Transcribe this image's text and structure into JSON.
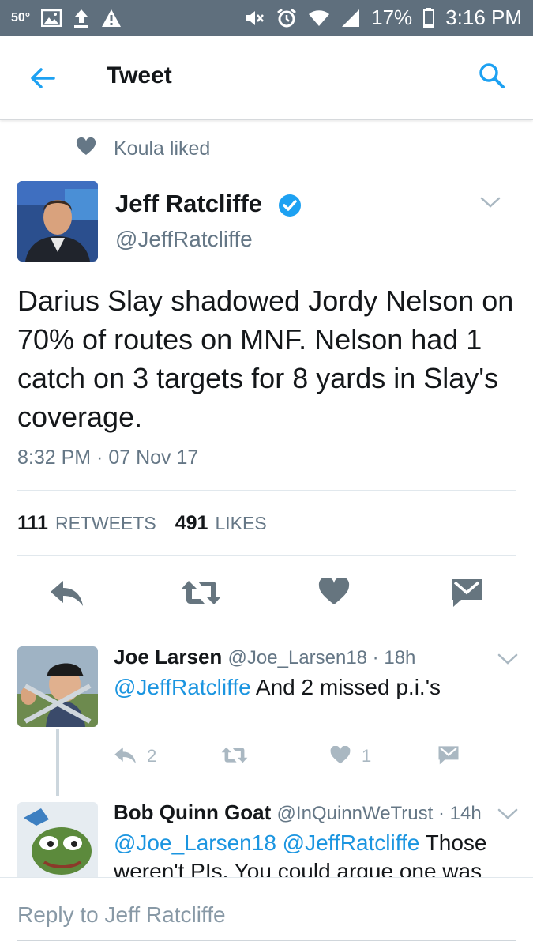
{
  "status_bar": {
    "temperature": "50°",
    "battery_percent": "17%",
    "time": "3:16 PM",
    "left_icons": [
      "image-icon",
      "upload-icon",
      "warning-icon"
    ],
    "right_icons": [
      "mute-icon",
      "alarm-icon",
      "wifi-icon",
      "signal-icon",
      "battery-icon"
    ]
  },
  "header": {
    "title": "Tweet",
    "back_icon": "back-arrow-icon",
    "search_icon": "search-icon"
  },
  "liked_by": {
    "text": "Koula liked",
    "icon": "heart-icon"
  },
  "tweet": {
    "author_name": "Jeff Ratcliffe",
    "author_handle": "@JeffRatcliffe",
    "verified": true,
    "text": "Darius Slay shadowed Jordy Nelson on 70% of routes on MNF. Nelson had 1 catch on 3 targets for 8 yards in Slay's coverage.",
    "timestamp": "8:32 PM · 07 Nov 17",
    "retweets_count": "111",
    "retweets_label": "RETWEETS",
    "likes_count": "491",
    "likes_label": "LIKES",
    "actions": [
      "reply-icon",
      "retweet-icon",
      "like-icon",
      "message-icon"
    ]
  },
  "replies": [
    {
      "name": "Joe Larsen",
      "handle": "@Joe_Larsen18",
      "time": "18h",
      "mentions": "@JeffRatcliffe",
      "text": "And 2 missed p.i.'s",
      "reply_count": "2",
      "like_count": "1"
    },
    {
      "name": "Bob Quinn Goat",
      "handle": "@InQuinnWeTrust",
      "time": "14h",
      "mentions": "@Joe_Larsen18 @JeffRatcliffe",
      "text_line1": "Those",
      "text_line2": "weren't PIs. You could argue one was"
    }
  ],
  "composer": {
    "placeholder": "Reply to Jeff Ratcliffe"
  },
  "colors": {
    "status_bar": "#5f6f7d",
    "accent": "#1da1f2",
    "mention": "#1b95e0",
    "secondary_text": "#657786",
    "action_icon": "#66757f"
  }
}
